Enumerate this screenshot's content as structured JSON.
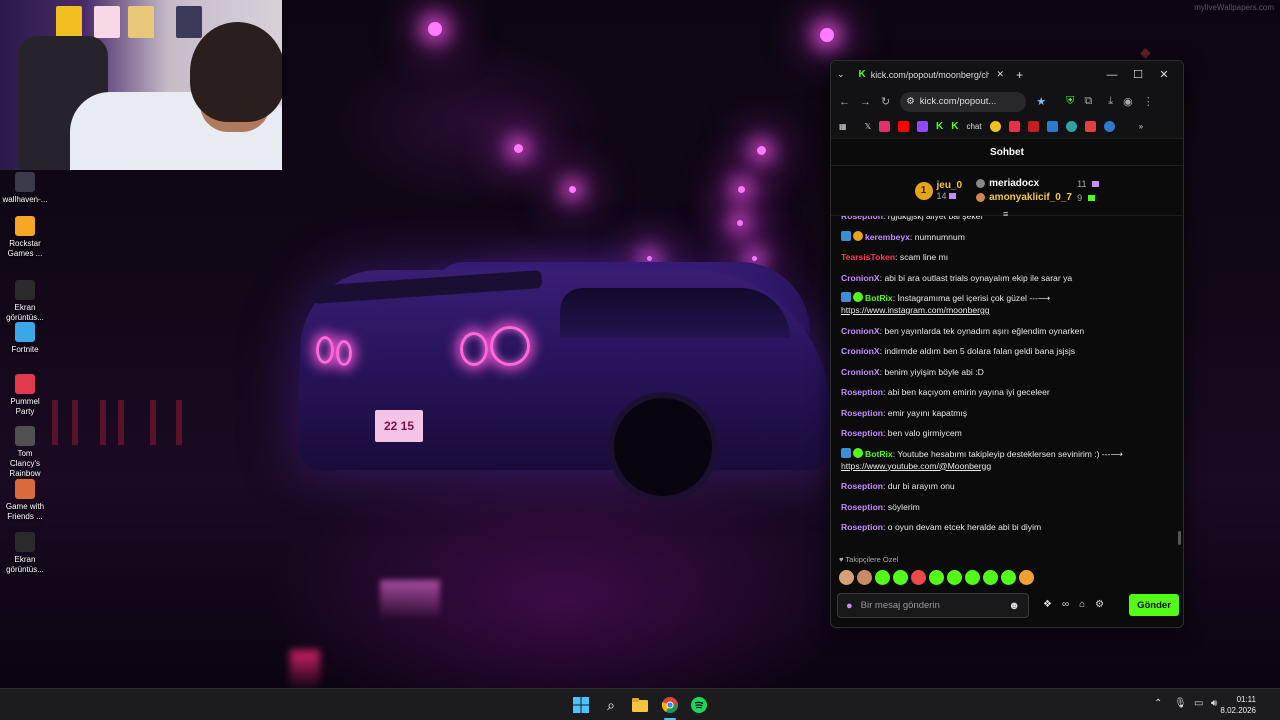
{
  "wallpaper": {
    "watermark": "myliveWallpapers.com",
    "plate": "22 15"
  },
  "desktop_icons": [
    {
      "label": "wallhaven-...",
      "icon": "image-file-icon",
      "color": "#3a3a4a"
    },
    {
      "label": "Rockstar Games ...",
      "icon": "rockstar-icon",
      "color": "#f5a623"
    },
    {
      "label": "Ekran görüntüs...",
      "icon": "image-file-icon",
      "color": "#2a2a2a"
    },
    {
      "label": "Fortnite",
      "icon": "fortnite-icon",
      "color": "#3aa7e8"
    },
    {
      "label": "Pummel Party",
      "icon": "pummel-party-icon",
      "color": "#e23a4a"
    },
    {
      "label": "Tom Clancy's Rainbow Si...",
      "icon": "rainbow-six-icon",
      "color": "#505050"
    },
    {
      "label": "Game with Friends ...",
      "icon": "game-with-friends-icon",
      "color": "#d96a3a"
    },
    {
      "label": "Ekran görüntüs...",
      "icon": "image-file-icon",
      "color": "#2a2a2a"
    }
  ],
  "browser": {
    "tab_title": "kick.com/popout/moonberg/ch",
    "url": "kick.com/popout...",
    "bookmark_chat": "chat",
    "colors": {
      "kick_green": "#53fc18"
    }
  },
  "chat": {
    "title": "Sohbet",
    "leaderboard": {
      "first": {
        "rank": "1",
        "name": "jeu_0",
        "count": "14"
      },
      "second": {
        "name": "meriadocx",
        "count": "11"
      },
      "third": {
        "name": "amonyaklicif_0_7",
        "count": "9"
      }
    },
    "messages": [
      {
        "user": "Roseption",
        "color": "#c58bff",
        "text": ": rgjdkgjskj aliyet bal şeker",
        "badges": []
      },
      {
        "user": "kerembeyx",
        "color": "#c58bff",
        "text": ": numnumnum",
        "badges": [
          "#3a8fd6",
          "#e6a41a"
        ]
      },
      {
        "user": "TearsisToken",
        "color": "#ff3a5a",
        "text": ": scam line mı",
        "badges": []
      },
      {
        "user": "CronionX",
        "color": "#c58bff",
        "text": ": abi bi ara outlast trials oynayalım ekip ile sarar ya",
        "badges": []
      },
      {
        "user": "BotRix",
        "color": "#53fc18",
        "text": ": İnstagramıma gel içerisi çok güzel ---⟶",
        "link": "https://www.instagram.com/moonbergg",
        "badges": [
          "#3a8fd6",
          "#53fc18"
        ]
      },
      {
        "user": "CronionX",
        "color": "#c58bff",
        "text": ": ben yayınlarda tek oynadım aşırı eğlendim oynarken",
        "badges": []
      },
      {
        "user": "CronionX",
        "color": "#c58bff",
        "text": ": indirmde aldım ben 5 dolara falan geldi bana jsjsjs",
        "badges": []
      },
      {
        "user": "CronionX",
        "color": "#c58bff",
        "text": ": benim yiyişim böyle abi :D",
        "badges": []
      },
      {
        "user": "Roseption",
        "color": "#c58bff",
        "text": ": abi ben kaçıyom emirin yayına iyi geceleer",
        "badges": []
      },
      {
        "user": "Roseption",
        "color": "#c58bff",
        "text": ": emir yayını kapatmış",
        "badges": []
      },
      {
        "user": "Roseption",
        "color": "#c58bff",
        "text": ": ben valo girmiycem",
        "badges": []
      },
      {
        "user": "BotRix",
        "color": "#53fc18",
        "text": ": Youtube hesabımı takipleyip desteklersen sevinirim :) ---⟶",
        "link": "https://www.youtube.com/@Moonbergg",
        "badges": [
          "#3a8fd6",
          "#53fc18"
        ]
      },
      {
        "user": "Roseption",
        "color": "#c58bff",
        "text": ": dur bi arayım onu",
        "badges": []
      },
      {
        "user": "Roseption",
        "color": "#c58bff",
        "text": ": söylerim",
        "badges": []
      },
      {
        "user": "Roseption",
        "color": "#c58bff",
        "text": ": o oyun devam etcek heralde abi bi diyim",
        "badges": []
      }
    ],
    "followers_label": "Takipçilere Özel",
    "emote_colors": [
      "#d8a07a",
      "#c98a6a",
      "#53fc18",
      "#53fc18",
      "#e84a4a",
      "#53fc18",
      "#53fc18",
      "#53fc18",
      "#53fc18",
      "#53fc18",
      "#f0a030"
    ],
    "input_placeholder": "Bir mesaj gönderin",
    "send_label": "Gönder"
  },
  "taskbar": {
    "time": "01:11",
    "date": "8.02.2026"
  }
}
